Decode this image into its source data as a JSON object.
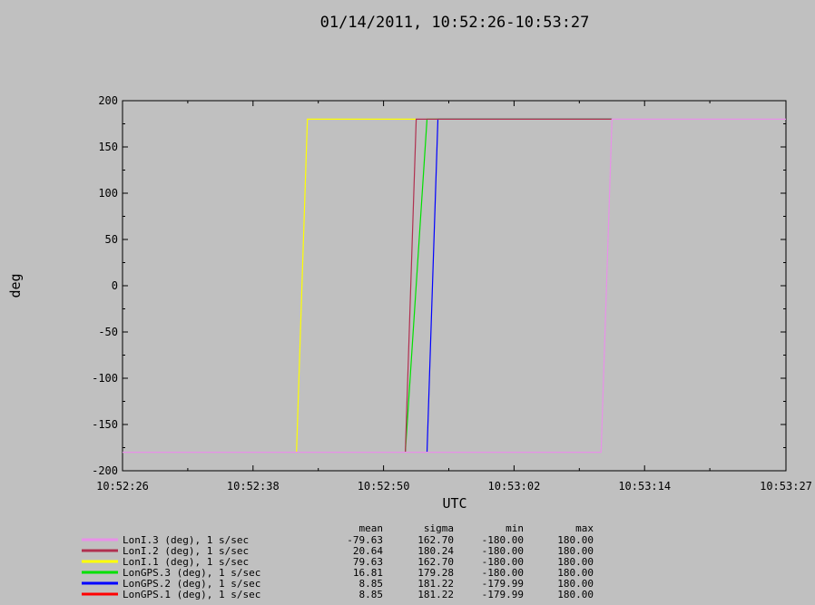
{
  "chart_data": {
    "type": "line",
    "title": "01/14/2011, 10:52:26-10:53:27",
    "xlabel": "UTC",
    "ylabel": "deg",
    "xlim": [
      "10:52:26",
      "10:53:27"
    ],
    "ylim": [
      -200,
      200
    ],
    "x_ticks": [
      "10:52:26",
      "10:52:38",
      "10:52:50",
      "10:53:02",
      "10:53:14",
      "10:53:27"
    ],
    "y_ticks": [
      200,
      150,
      100,
      50,
      0,
      -50,
      -100,
      -150,
      -200
    ],
    "grid": false,
    "legend_position": "bottom-left",
    "stats_headers": [
      "mean",
      "sigma",
      "min",
      "max"
    ],
    "series": [
      {
        "name": "LonI.3 (deg), 1 s/sec",
        "color": "#e890e8",
        "points": [
          [
            "10:52:26",
            -180
          ],
          [
            "10:53:10",
            -180
          ],
          [
            "10:53:11",
            180
          ],
          [
            "10:53:27",
            180
          ]
        ],
        "stats": [
          "-79.63",
          "162.70",
          "-180.00",
          "180.00"
        ]
      },
      {
        "name": "LonI.2 (deg), 1 s/sec",
        "color": "#b03050",
        "points": [
          [
            "10:52:52",
            -180
          ],
          [
            "10:52:53",
            180
          ],
          [
            "10:53:11",
            180
          ]
        ],
        "stats": [
          "20.64",
          "180.24",
          "-180.00",
          "180.00"
        ]
      },
      {
        "name": "LonI.1 (deg), 1 s/sec",
        "color": "#ffff00",
        "points": [
          [
            "10:52:42",
            -180
          ],
          [
            "10:52:43",
            180
          ],
          [
            "10:52:53",
            180
          ]
        ],
        "stats": [
          "79.63",
          "162.70",
          "-180.00",
          "180.00"
        ]
      },
      {
        "name": "LonGPS.3 (deg), 1 s/sec",
        "color": "#00e000",
        "points": [
          [
            "10:52:52",
            -180
          ],
          [
            "10:52:54",
            180
          ],
          [
            "10:53:11",
            180
          ]
        ],
        "stats": [
          "16.81",
          "179.28",
          "-180.00",
          "180.00"
        ]
      },
      {
        "name": "LonGPS.2 (deg), 1 s/sec",
        "color": "#0000ff",
        "points": [
          [
            "10:52:54",
            -180
          ],
          [
            "10:52:55",
            180
          ],
          [
            "10:53:11",
            180
          ]
        ],
        "stats": [
          "8.85",
          "181.22",
          "-179.99",
          "180.00"
        ]
      },
      {
        "name": "LonGPS.1 (deg), 1 s/sec",
        "color": "#ff0000",
        "points": [],
        "stats": [
          "8.85",
          "181.22",
          "-179.99",
          "180.00"
        ]
      }
    ]
  }
}
